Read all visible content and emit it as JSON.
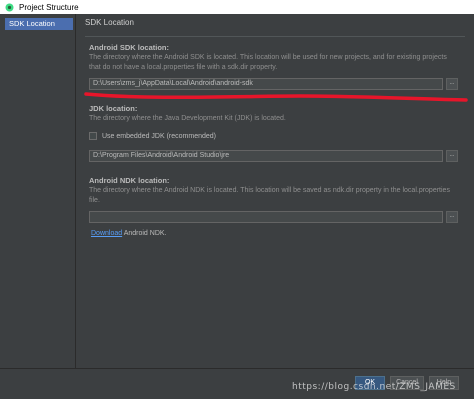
{
  "window": {
    "title": "Project Structure"
  },
  "sidebar": {
    "items": [
      {
        "label": "SDK Location",
        "selected": true
      }
    ]
  },
  "main": {
    "page_title": "SDK Location",
    "android_sdk": {
      "title": "Android SDK location:",
      "description": "The directory where the Android SDK is located. This location will be used for new projects, and for existing projects that do not have a local.properties file with a sdk.dir property.",
      "path": "D:\\Users\\zms_j\\AppData\\Local\\Android\\android-sdk"
    },
    "jdk": {
      "title": "JDK location:",
      "description": "The directory where the Java Development Kit (JDK) is located.",
      "embedded_label": "Use embedded JDK (recommended)",
      "embedded_checked": false,
      "path": "D:\\Program Files\\Android\\Android Studio\\jre"
    },
    "ndk": {
      "title": "Android NDK location:",
      "description": "The directory where the Android NDK is located. This location will be saved as ndk.dir property in the local.properties file.",
      "path": "",
      "download_link": "Download",
      "download_suffix": " Android NDK."
    },
    "browse_label": "..."
  },
  "footer": {
    "ok_label": "OK",
    "cancel_label": "Cancel",
    "help_label": "Help"
  },
  "watermark": "https://blog.csdn.net/ZMS_JAMES",
  "colors": {
    "annotation_underline": "#e8152a",
    "selection": "#4b6eaf",
    "link": "#589df6"
  }
}
